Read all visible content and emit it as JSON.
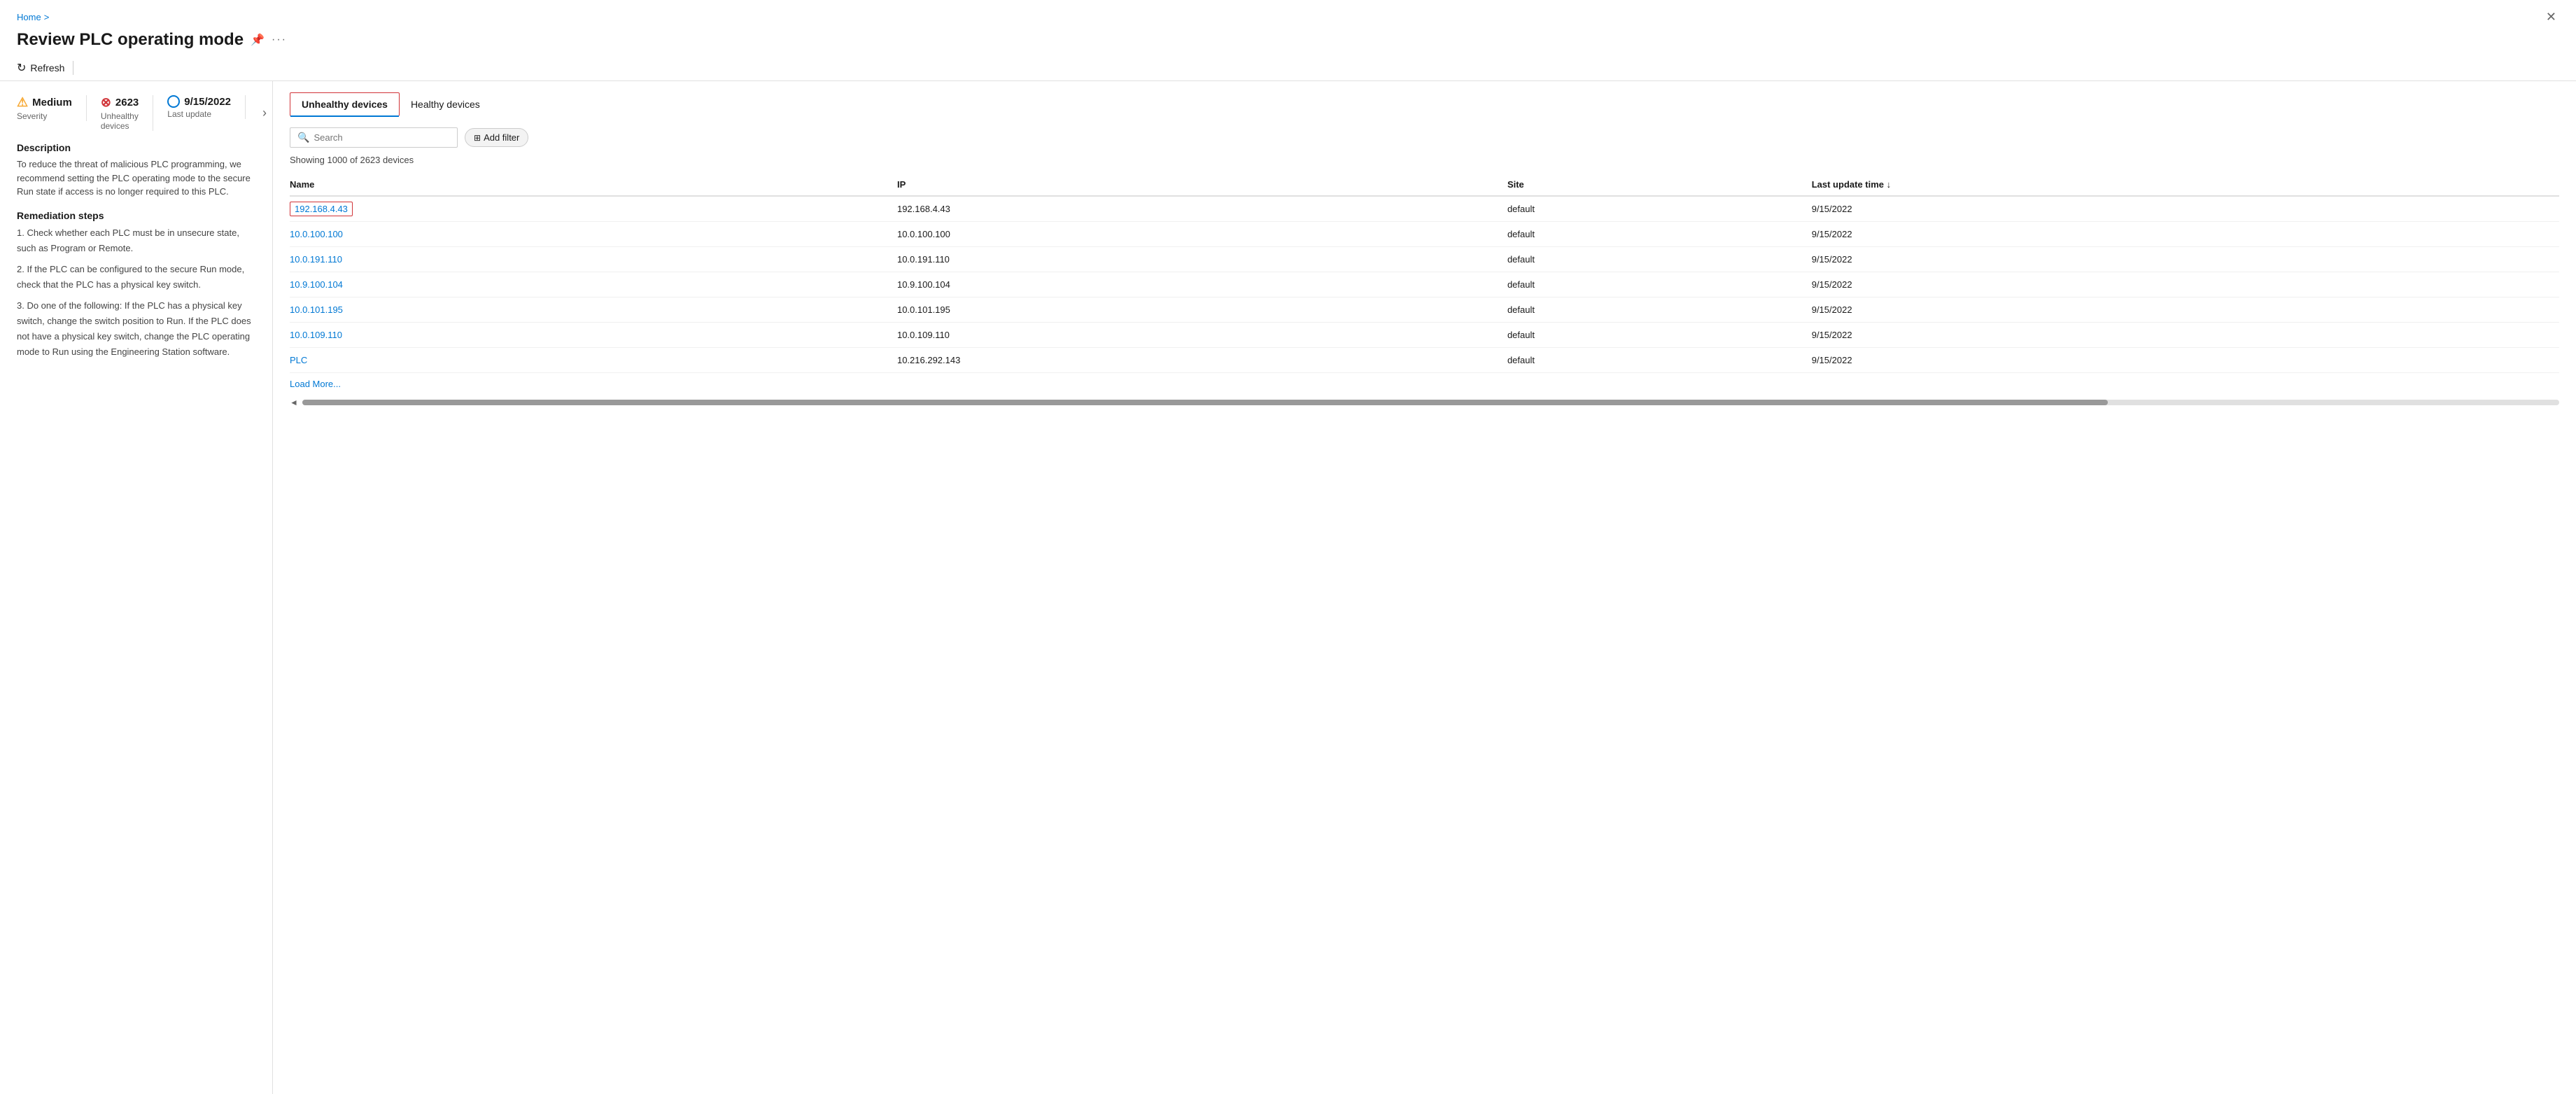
{
  "breadcrumb": {
    "home": "Home",
    "separator": ">"
  },
  "page": {
    "title": "Review PLC operating mode"
  },
  "toolbar": {
    "refresh_label": "Refresh",
    "divider": "|"
  },
  "left_panel": {
    "severity": {
      "value": "Medium",
      "label": "Severity",
      "icon": "warning"
    },
    "unhealthy": {
      "value": "2623",
      "label": "Unhealthy devices",
      "icon": "error"
    },
    "last_update": {
      "value": "9/15/2022",
      "label": "Last update",
      "icon": "clock"
    },
    "description": {
      "title": "Description",
      "text": "To reduce the threat of malicious PLC programming, we recommend setting the PLC operating mode to the secure Run state if access is no longer required to this PLC."
    },
    "remediation": {
      "title": "Remediation steps",
      "steps": [
        "1. Check whether each PLC must be in unsecure state, such as Program or Remote.",
        "2. If the PLC can be configured to the secure Run mode, check that the PLC has a physical key switch.",
        "3. Do one of the following: If the PLC has a physical key switch, change the switch position to Run. If the PLC does not have a physical key switch, change the PLC operating mode to Run using the Engineering Station software."
      ]
    }
  },
  "right_panel": {
    "tabs": [
      {
        "id": "unhealthy",
        "label": "Unhealthy devices",
        "active": true
      },
      {
        "id": "healthy",
        "label": "Healthy devices",
        "active": false
      }
    ],
    "search": {
      "placeholder": "Search",
      "add_filter_label": "Add filter"
    },
    "showing_count": "Showing 1000 of 2623 devices",
    "table": {
      "columns": [
        {
          "id": "name",
          "label": "Name",
          "sortable": false
        },
        {
          "id": "ip",
          "label": "IP",
          "sortable": false
        },
        {
          "id": "site",
          "label": "Site",
          "sortable": false
        },
        {
          "id": "last_update",
          "label": "Last update time",
          "sortable": true,
          "sort_dir": "desc"
        }
      ],
      "rows": [
        {
          "name": "192.168.4.43",
          "ip": "192.168.4.43",
          "site": "default",
          "last_update": "9/15/2022",
          "selected": true
        },
        {
          "name": "10.0.100.100",
          "ip": "10.0.100.100",
          "site": "default",
          "last_update": "9/15/2022",
          "selected": false
        },
        {
          "name": "10.0.191.110",
          "ip": "10.0.191.110",
          "site": "default",
          "last_update": "9/15/2022",
          "selected": false
        },
        {
          "name": "10.9.100.104",
          "ip": "10.9.100.104",
          "site": "default",
          "last_update": "9/15/2022",
          "selected": false
        },
        {
          "name": "10.0.101.195",
          "ip": "10.0.101.195",
          "site": "default",
          "last_update": "9/15/2022",
          "selected": false
        },
        {
          "name": "10.0.109.110",
          "ip": "10.0.109.110",
          "site": "default",
          "last_update": "9/15/2022",
          "selected": false
        },
        {
          "name": "PLC",
          "ip": "10.216.292.143",
          "site": "default",
          "last_update": "9/15/2022",
          "selected": false
        }
      ],
      "load_more_label": "Load More..."
    }
  },
  "icons": {
    "warning": "⚠",
    "error": "✖",
    "clock": "○",
    "pin": "📌",
    "more": "···",
    "close": "✕",
    "refresh": "↻",
    "search": "🔍",
    "filter": "⊞",
    "sort_desc": "↓",
    "chevron_right": "›"
  }
}
